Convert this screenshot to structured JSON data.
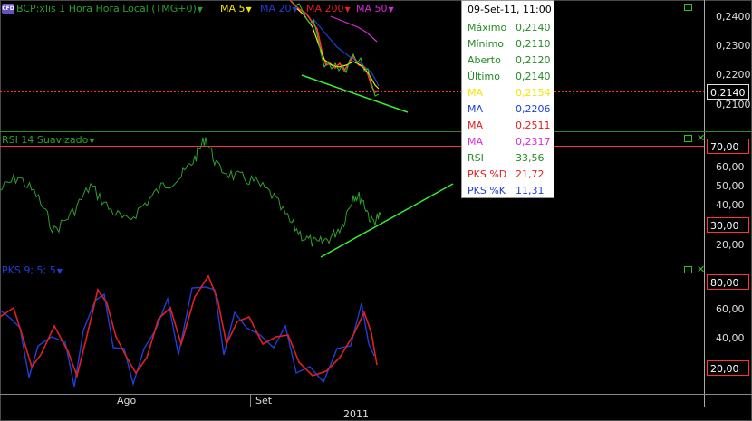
{
  "header": {
    "badge": "CFD",
    "symbol": "BCP:xlis 1 Hora Hora Local (TMG+0)",
    "ma5": "MA 5",
    "ma20": "MA 20",
    "ma200": "MA 200",
    "ma50": "MA 50"
  },
  "rsi_header": "RSI 14 Suavizado",
  "pks_header": "PKS 9; 5; 5",
  "tooltip": {
    "title": "09-Set-11, 11:00",
    "rows": [
      {
        "label": "Máximo",
        "value": "0,2140",
        "color": "#228b22"
      },
      {
        "label": "Mínimo",
        "value": "0,2110",
        "color": "#228b22"
      },
      {
        "label": "Aberto",
        "value": "0,2120",
        "color": "#228b22"
      },
      {
        "label": "Último",
        "value": "0,2140",
        "color": "#228b22"
      },
      {
        "label": "MA",
        "value": "0,2154",
        "color": "#f2e600"
      },
      {
        "label": "MA",
        "value": "0,2206",
        "color": "#1f3fd6"
      },
      {
        "label": "MA",
        "value": "0,2511",
        "color": "#e02020"
      },
      {
        "label": "MA",
        "value": "0,2317",
        "color": "#d62ad6"
      },
      {
        "label": "RSI",
        "value": "33,56",
        "color": "#228b22"
      },
      {
        "label": "PKS %D",
        "value": "21,72",
        "color": "#e02020"
      },
      {
        "label": "PKS %K",
        "value": "11,31",
        "color": "#1f3fd6"
      }
    ]
  },
  "price_axis": [
    "0,2400",
    "0,2300",
    "0,2200",
    "0,2100"
  ],
  "current_price": "0,2140",
  "rsi_axis": [
    "60,00",
    "50,00",
    "40,00",
    "20,00"
  ],
  "rsi_levels": [
    "70,00",
    "30,00"
  ],
  "pks_axis": [
    "60,00",
    "40,00"
  ],
  "pks_levels": [
    "80,00",
    "20,00"
  ],
  "x_labels": [
    "Ago",
    "Set"
  ],
  "year_label": "2011",
  "colors": {
    "green": "#2ec22e",
    "red": "#ff3333",
    "blue": "#1f3fd6",
    "yellow": "#f2e600",
    "magenta": "#d62ad6"
  },
  "icons": [
    "maximize-icon",
    "close-icon"
  ]
}
